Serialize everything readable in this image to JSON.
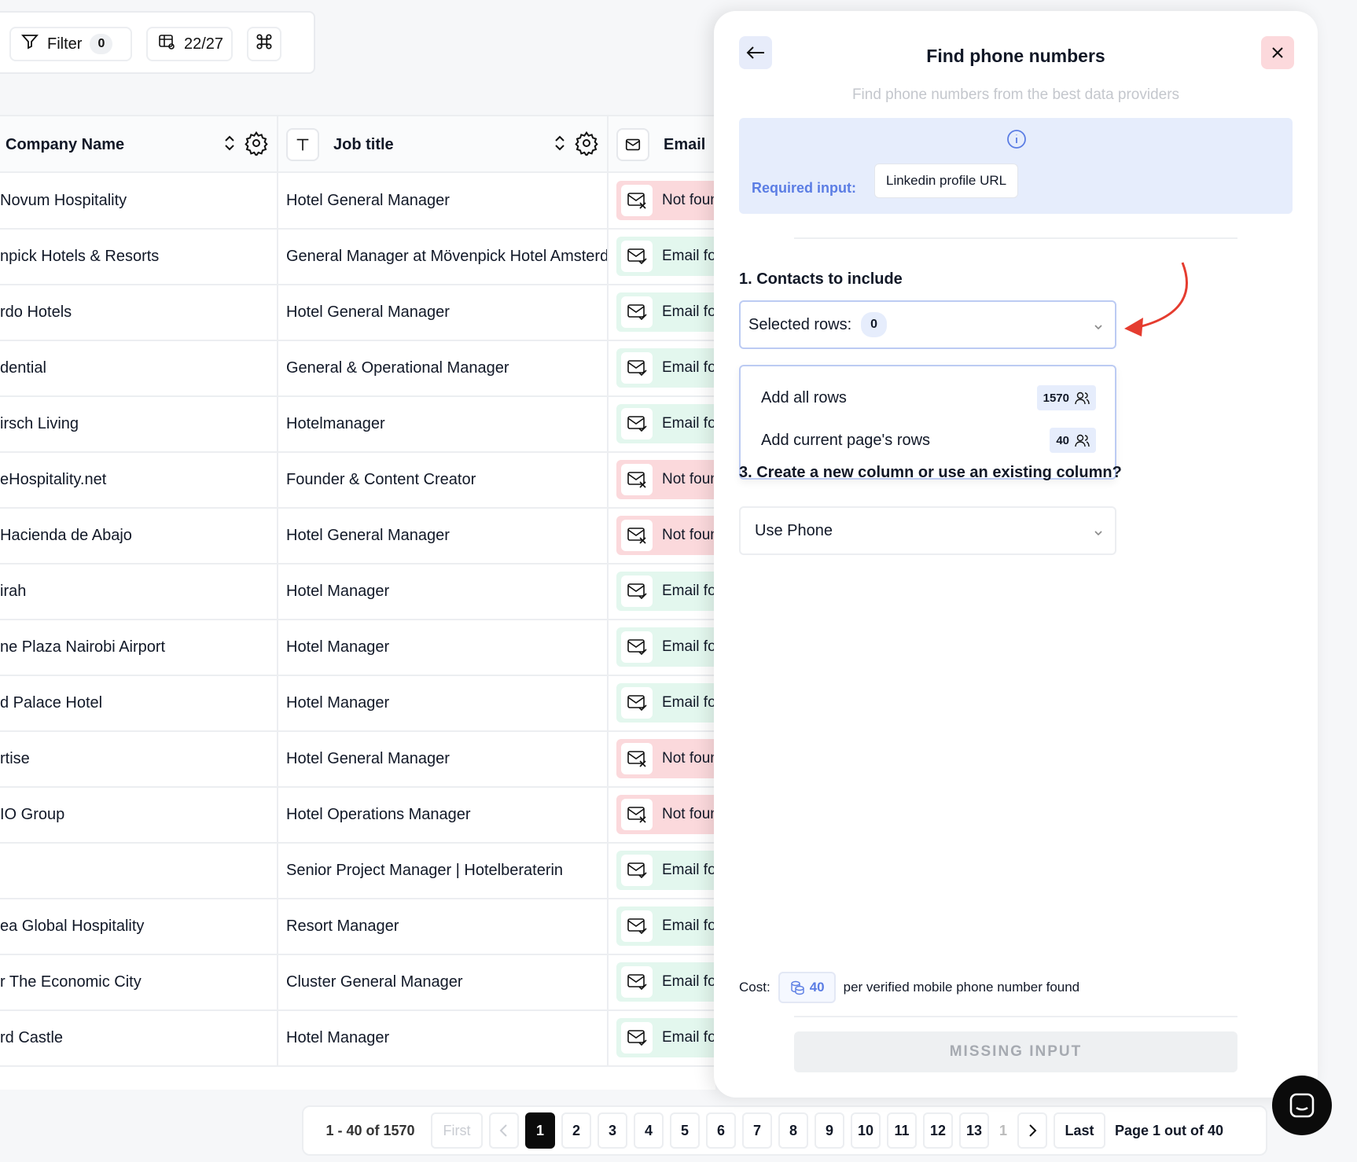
{
  "toolbar": {
    "filter_label": "Filter",
    "filter_count": "0",
    "columns_label": "22/27"
  },
  "table": {
    "headers": {
      "company": "Company Name",
      "job_title": "Job title",
      "email": "Email"
    },
    "rows": [
      {
        "company": "Novum Hospitality",
        "job": "Hotel General Manager",
        "email": "Not found",
        "status": "notfound"
      },
      {
        "company": "npick Hotels & Resorts",
        "job": "General Manager at Mövenpick Hotel Amsterdam",
        "email": "Email found",
        "status": "found"
      },
      {
        "company": "rdo Hotels",
        "job": "Hotel General Manager",
        "email": "Email found",
        "status": "found"
      },
      {
        "company": "dential",
        "job": "General & Operational Manager",
        "email": "Email found",
        "status": "found"
      },
      {
        "company": "irsch Living",
        "job": "Hotelmanager",
        "email": "Email found",
        "status": "found"
      },
      {
        "company": "eHospitality.net",
        "job": "Founder & Content Creator",
        "email": "Not found",
        "status": "notfound"
      },
      {
        "company": "Hacienda de Abajo",
        "job": "Hotel General Manager",
        "email": "Not found",
        "status": "notfound"
      },
      {
        "company": "irah",
        "job": "Hotel Manager",
        "email": "Email found",
        "status": "found"
      },
      {
        "company": "ne Plaza Nairobi Airport",
        "job": "Hotel Manager",
        "email": "Email found",
        "status": "found"
      },
      {
        "company": "d Palace Hotel",
        "job": "Hotel Manager",
        "email": "Email found",
        "status": "found"
      },
      {
        "company": "rtise",
        "job": "Hotel General Manager",
        "email": "Not found",
        "status": "notfound"
      },
      {
        "company": "IO Group",
        "job": "Hotel Operations Manager",
        "email": "Not found",
        "status": "notfound"
      },
      {
        "company": "",
        "job": "Senior Project Manager | Hotelberaterin",
        "email": "Email found",
        "status": "found"
      },
      {
        "company": "ea Global Hospitality",
        "job": "Resort Manager",
        "email": "Email found",
        "status": "found"
      },
      {
        "company": "r The Economic City",
        "job": "Cluster General Manager",
        "email": "Email found",
        "status": "found"
      },
      {
        "company": "rd Castle",
        "job": "Hotel Manager",
        "email": "Email found",
        "status": "found"
      }
    ]
  },
  "pagination": {
    "range": "1 - 40 of 1570",
    "first": "First",
    "pages": [
      "1",
      "2",
      "3",
      "4",
      "5",
      "6",
      "7",
      "8",
      "9",
      "10",
      "11",
      "12",
      "13",
      "1"
    ],
    "last": "Last",
    "page_info": "Page 1 out of 40"
  },
  "panel": {
    "title": "Find phone numbers",
    "subtitle": "Find phone numbers from the best data providers",
    "required_label": "Required input:",
    "required_value": "Linkedin profile URL",
    "section1": "1. Contacts to include",
    "selected_rows_label": "Selected rows:",
    "selected_rows_count": "0",
    "dropdown": [
      {
        "label": "Add all rows",
        "count": "1570"
      },
      {
        "label": "Add current page's rows",
        "count": "40"
      }
    ],
    "section3": "3. Create a new column or use an existing column?",
    "column_select": "Use Phone",
    "cost_label": "Cost:",
    "cost_value": "40",
    "cost_desc": "per verified mobile phone number found",
    "action_button": "MISSING INPUT"
  },
  "colors": {
    "accent": "#5b7de4",
    "found_bg": "#e3f7ee",
    "notfound_bg": "#fbd9dc",
    "arrow": "#e53c2f"
  }
}
